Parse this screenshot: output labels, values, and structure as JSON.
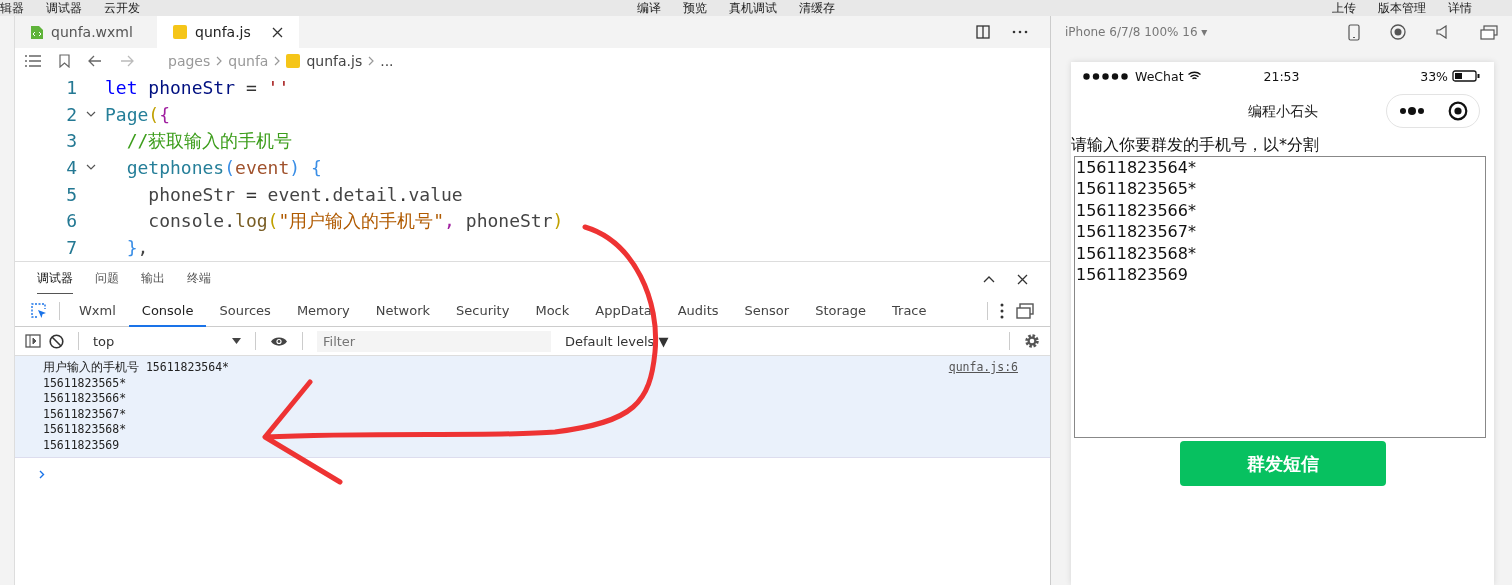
{
  "menu_bar": {
    "left": [
      "辑器",
      "调试器",
      "云开发"
    ],
    "center": [
      "编译",
      "预览",
      "真机调试",
      "清缓存"
    ],
    "right": [
      "上传",
      "版本管理",
      "详情"
    ]
  },
  "editor": {
    "tabs": [
      {
        "label": "qunfa.wxml",
        "kind": "wxml",
        "selected": false
      },
      {
        "label": "qunfa.js",
        "kind": "js",
        "selected": true
      }
    ],
    "breadcrumb": [
      {
        "label": "pages",
        "kind": "folder"
      },
      {
        "label": "qunfa",
        "kind": "folder"
      },
      {
        "label": "qunfa.js",
        "kind": "js"
      },
      {
        "label": "...",
        "kind": "more"
      }
    ],
    "lines": [
      {
        "number": "1",
        "fold": false,
        "tokens": [
          {
            "text": "let",
            "kind": "kw"
          },
          {
            "text": " phoneStr ",
            "kind": "var"
          },
          {
            "text": "=",
            "kind": "op"
          },
          {
            "text": " ''",
            "kind": "str"
          }
        ]
      },
      {
        "number": "2",
        "fold": true,
        "tokens": [
          {
            "text": "Page",
            "kind": "fn"
          },
          {
            "text": "(",
            "kind": "paren"
          },
          {
            "text": "{",
            "kind": "brace"
          }
        ]
      },
      {
        "number": "3",
        "fold": false,
        "tokens": [
          {
            "text": "  //获取输入的手机号",
            "kind": "comment"
          }
        ]
      },
      {
        "number": "4",
        "fold": true,
        "tokens": [
          {
            "text": "  getphones",
            "kind": "fn"
          },
          {
            "text": "(",
            "kind": "paren2"
          },
          {
            "text": "event",
            "kind": "param"
          },
          {
            "text": ")",
            "kind": "paren2"
          },
          {
            "text": " {",
            "kind": "brace2"
          }
        ]
      },
      {
        "number": "5",
        "fold": false,
        "tokens": [
          {
            "text": "    phoneStr ",
            "kind": "plain"
          },
          {
            "text": "=",
            "kind": "op"
          },
          {
            "text": " event",
            "kind": "plain"
          },
          {
            "text": ".",
            "kind": "op"
          },
          {
            "text": "detail",
            "kind": "plain"
          },
          {
            "text": ".",
            "kind": "op"
          },
          {
            "text": "value",
            "kind": "plain"
          }
        ]
      },
      {
        "number": "6",
        "fold": false,
        "tokens": [
          {
            "text": "    console",
            "kind": "plain"
          },
          {
            "text": ".",
            "kind": "op"
          },
          {
            "text": "log",
            "kind": "method"
          },
          {
            "text": "(",
            "kind": "paren"
          },
          {
            "text": "\"用户输入的手机号\"",
            "kind": "strtext"
          },
          {
            "text": ", ",
            "kind": "brace"
          },
          {
            "text": "phoneStr",
            "kind": "plain"
          },
          {
            "text": ")",
            "kind": "paren"
          }
        ]
      },
      {
        "number": "7",
        "fold": false,
        "tokens": [
          {
            "text": "  }",
            "kind": "brace2"
          },
          {
            "text": ",",
            "kind": "plain"
          }
        ]
      }
    ]
  },
  "debugger": {
    "tabs": [
      {
        "label": "调试器",
        "selected": true
      },
      {
        "label": "问题",
        "selected": false
      },
      {
        "label": "输出",
        "selected": false
      },
      {
        "label": "终端",
        "selected": false
      }
    ],
    "devtools_tabs": [
      {
        "label": "Wxml",
        "selected": false
      },
      {
        "label": "Console",
        "selected": true
      },
      {
        "label": "Sources",
        "selected": false
      },
      {
        "label": "Memory",
        "selected": false
      },
      {
        "label": "Network",
        "selected": false
      },
      {
        "label": "Security",
        "selected": false
      },
      {
        "label": "Mock",
        "selected": false
      },
      {
        "label": "AppData",
        "selected": false
      },
      {
        "label": "Audits",
        "selected": false
      },
      {
        "label": "Sensor",
        "selected": false
      },
      {
        "label": "Storage",
        "selected": false
      },
      {
        "label": "Trace",
        "selected": false
      }
    ],
    "context": "top",
    "filter": {
      "placeholder": "Filter"
    },
    "levels": "Default levels ▼",
    "messages": [
      {
        "lines": [
          "用户输入的手机号 15611823564*",
          "15611823565*",
          "15611823566*",
          "15611823567*",
          "15611823568*",
          "15611823569"
        ],
        "source": "qunfa.js:6"
      }
    ]
  },
  "simulator": {
    "device": "iPhone 6/7/8 100% 16 ▾",
    "status_bar": {
      "carrier": "WeChat",
      "time": "21:53",
      "battery": "33%"
    },
    "nav_title": "编程小石头",
    "prompt": "请输入你要群发的手机号，以*分割",
    "textarea": {
      "value": "15611823564*\n15611823565*\n15611823566*\n15611823567*\n15611823568*\n15611823569"
    },
    "button": "群发短信"
  }
}
